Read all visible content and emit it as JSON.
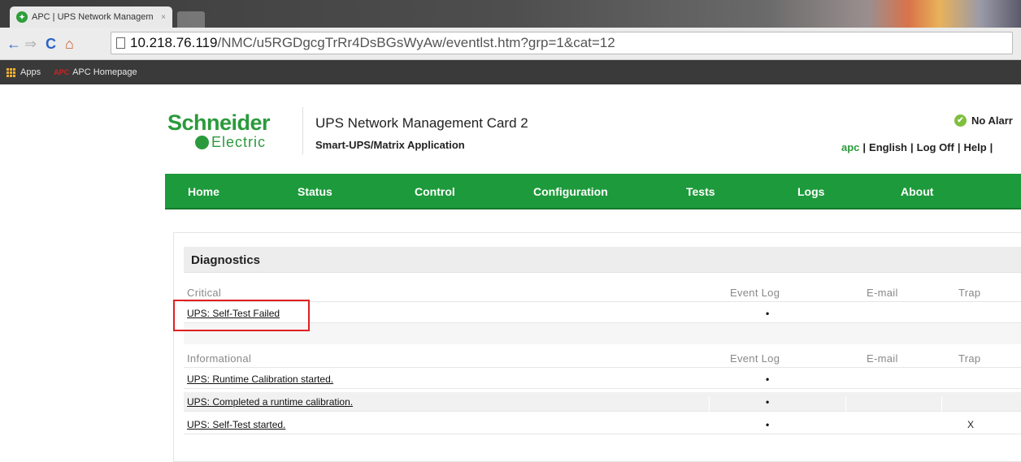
{
  "browser": {
    "tab_title": "APC | UPS Network Managem",
    "tab_close": "×",
    "favicon_text": "✦",
    "url_host": "10.218.76.119",
    "url_path": "/NMC/u5RGDgcgTrRr4DsBGsWyAw/eventlst.htm?grp=1&cat=12",
    "bookmarks": [
      {
        "label": "Apps",
        "icon": "apps-grid-icon"
      },
      {
        "label": "APC Homepage",
        "icon": "apc-logo-icon",
        "icon_text": "APC"
      }
    ]
  },
  "header": {
    "logo_top": "Schneider",
    "logo_bottom": "Electric",
    "product_title": "UPS Network Management Card 2",
    "product_subtitle": "Smart-UPS/Matrix Application",
    "alarm_status": "No Alarr",
    "user": "apc",
    "links": [
      "English",
      "Log Off",
      "Help"
    ],
    "separator": "|"
  },
  "nav": {
    "items": [
      "Home",
      "Status",
      "Control",
      "Configuration",
      "Tests",
      "Logs",
      "About"
    ],
    "color": "#1d9a3b"
  },
  "diagnostics": {
    "title": "Diagnostics",
    "columns": [
      "Event Log",
      "E-mail",
      "Trap"
    ],
    "critical": {
      "label": "Critical",
      "events": [
        {
          "name": "UPS: Self-Test Failed",
          "event_log": "•",
          "email": "",
          "trap": ""
        }
      ]
    },
    "informational": {
      "label": "Informational",
      "events": [
        {
          "name": "UPS: Runtime Calibration started.",
          "event_log": "•",
          "email": "",
          "trap": ""
        },
        {
          "name": "UPS: Completed a runtime calibration.",
          "event_log": "•",
          "email": "",
          "trap": ""
        },
        {
          "name": "UPS: Self-Test started.",
          "event_log": "•",
          "email": "",
          "trap": "X"
        }
      ]
    },
    "highlight_color": "#e02020"
  }
}
